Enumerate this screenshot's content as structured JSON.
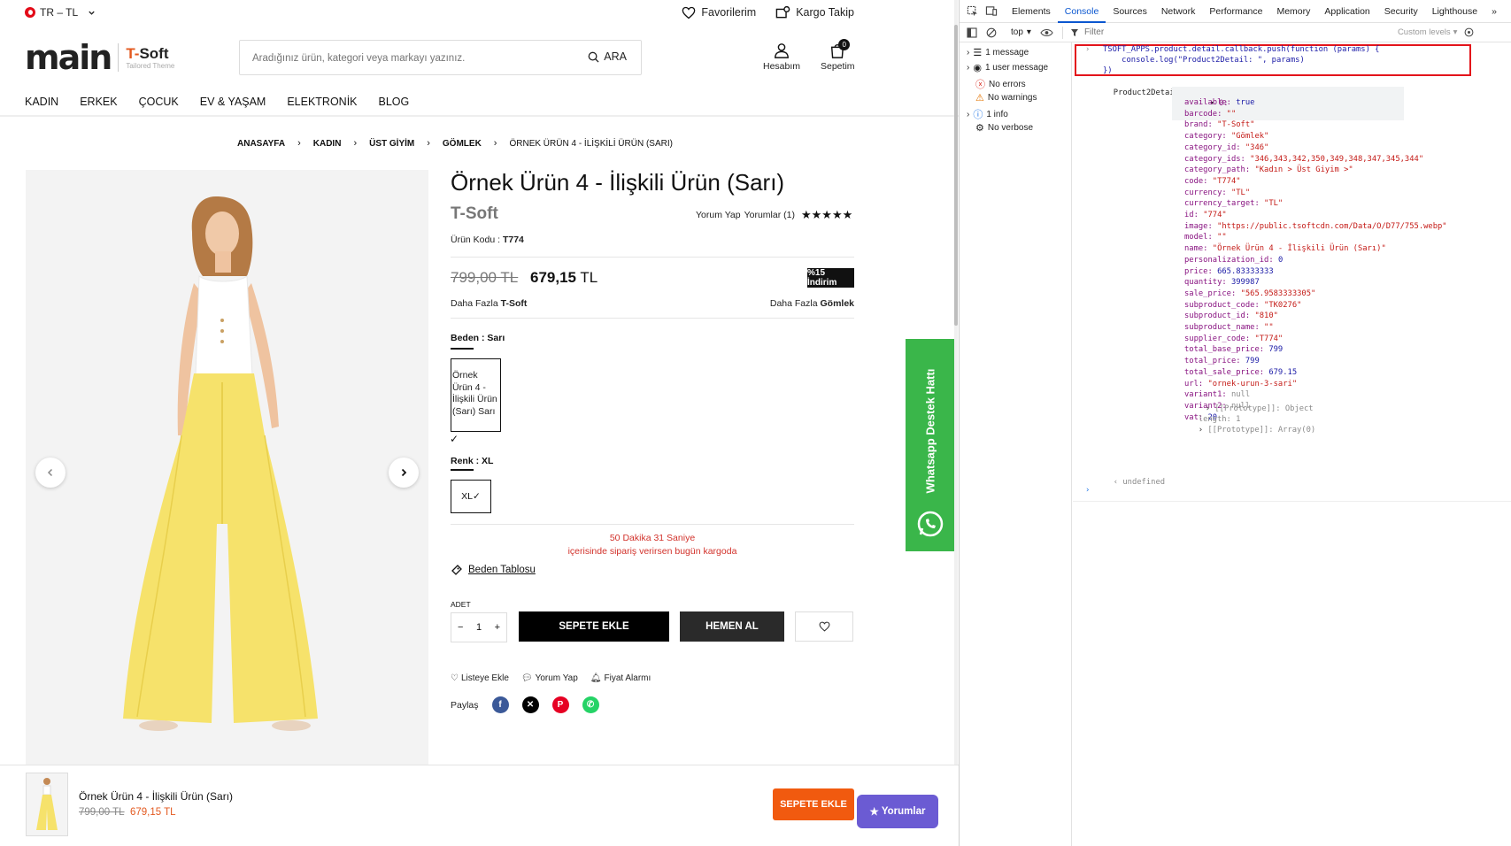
{
  "shop": {
    "locale": "TR – TL",
    "top_links": {
      "favorites": "Favorilerim",
      "cargo": "Kargo Takip"
    },
    "logo": {
      "main": "main",
      "tsoft_t": "T-",
      "tsoft_soft": "Soft",
      "tagline": "Tailored Theme"
    },
    "search": {
      "placeholder": "Aradığınız ürün, kategori veya markayı yazınız.",
      "button": "ARA"
    },
    "account_label": "Hesabım",
    "cart_label": "Sepetim",
    "cart_count": "0",
    "nav": [
      "KADIN",
      "ERKEK",
      "ÇOCUK",
      "EV & YAŞAM",
      "ELEKTRONİK",
      "BLOG"
    ],
    "breadcrumb": [
      "ANASAYFA",
      "KADIN",
      "ÜST GİYİM",
      "GÖMLEK",
      "ÖRNEK ÜRÜN 4 - İLİŞKİLİ ÜRÜN (SARI)"
    ],
    "product": {
      "title": "Örnek Ürün 4 - İlişkili Ürün (Sarı)",
      "brand": "T-Soft",
      "review_link": "Yorum Yap",
      "reviews_count": "Yorumlar (1)",
      "rating": 5,
      "code_label": "Ürün Kodu :",
      "code": "T774",
      "old_price": "799,00 TL",
      "price_value": "679,15",
      "price_currency": "TL",
      "discount": "%15 İndirim",
      "more_brand_label": "Daha Fazla",
      "more_brand": "T-Soft",
      "more_cat_label": "Daha Fazla",
      "more_cat": "Gömlek",
      "size_option_label": "Beden : Sarı",
      "variant_alt": "Örnek Ürün 4 - İlişkili Ürün (Sarı) Sarı",
      "color_option_label": "Renk : XL",
      "size_value": "XL",
      "timer_line1": "50 Dakika 31 Saniye",
      "timer_line2": "içerisinde sipariş verirsen bugün kargoda",
      "size_table": "Beden Tablosu",
      "qty_label": "ADET",
      "qty": "1",
      "add_to_cart": "SEPETE EKLE",
      "buy_now": "HEMEN AL",
      "mini_actions": [
        "Listeye Ekle",
        "Yorum Yap",
        "Fiyat Alarmı"
      ],
      "share_label": "Paylaş"
    },
    "whatsapp": "Whatsapp Destek Hattı",
    "sticky": {
      "name": "Örnek Ürün 4 - İlişkili Ürün (Sarı)",
      "old_price": "799,00 TL",
      "price": "679,15 TL",
      "add_to_cart": "SEPETE EKLE",
      "reviews": "Yorumlar"
    }
  },
  "devtools": {
    "tabs": [
      "Elements",
      "Console",
      "Sources",
      "Network",
      "Performance",
      "Memory",
      "Application",
      "Security",
      "Lighthouse"
    ],
    "active_tab": "Console",
    "context": "top",
    "filter_placeholder": "Filter",
    "levels": "Custom levels",
    "sidebar": [
      "1 message",
      "1 user message",
      "No errors",
      "No warnings",
      "1 info",
      "No verbose"
    ],
    "code": [
      "TSOFT_APPS.product.detail.callback.push(function (params) {",
      "    console.log(\"Product2Detail: \", params)",
      "})"
    ],
    "log_label": "Product2Detail: ",
    "array_summary": "[{…}]",
    "index_label": "0:",
    "fields": [
      {
        "key": "available",
        "value": "true",
        "type": "bool"
      },
      {
        "key": "barcode",
        "value": "\"\"",
        "type": "str"
      },
      {
        "key": "brand",
        "value": "\"T-Soft\"",
        "type": "str"
      },
      {
        "key": "category",
        "value": "\"Gömlek\"",
        "type": "str"
      },
      {
        "key": "category_id",
        "value": "\"346\"",
        "type": "str"
      },
      {
        "key": "category_ids",
        "value": "\"346,343,342,350,349,348,347,345,344\"",
        "type": "str"
      },
      {
        "key": "category_path",
        "value": "\"Kadın > Üst Giyim >\"",
        "type": "str"
      },
      {
        "key": "code",
        "value": "\"T774\"",
        "type": "str"
      },
      {
        "key": "currency",
        "value": "\"TL\"",
        "type": "str"
      },
      {
        "key": "currency_target",
        "value": "\"TL\"",
        "type": "str"
      },
      {
        "key": "id",
        "value": "\"774\"",
        "type": "str"
      },
      {
        "key": "image",
        "value": "\"https://public.tsoftcdn.com/Data/O/D77/755.webp\"",
        "type": "str"
      },
      {
        "key": "model",
        "value": "\"\"",
        "type": "str"
      },
      {
        "key": "name",
        "value": "\"Örnek Ürün 4 - İlişkili Ürün (Sarı)\"",
        "type": "str"
      },
      {
        "key": "personalization_id",
        "value": "0",
        "type": "num"
      },
      {
        "key": "price",
        "value": "665.83333333",
        "type": "num"
      },
      {
        "key": "quantity",
        "value": "399987",
        "type": "num"
      },
      {
        "key": "sale_price",
        "value": "\"565.9583333305\"",
        "type": "str"
      },
      {
        "key": "subproduct_code",
        "value": "\"TK0276\"",
        "type": "str"
      },
      {
        "key": "subproduct_id",
        "value": "\"810\"",
        "type": "str"
      },
      {
        "key": "subproduct_name",
        "value": "\"\"",
        "type": "str"
      },
      {
        "key": "supplier_code",
        "value": "\"T774\"",
        "type": "str"
      },
      {
        "key": "total_base_price",
        "value": "799",
        "type": "num"
      },
      {
        "key": "total_price",
        "value": "799",
        "type": "num"
      },
      {
        "key": "total_sale_price",
        "value": "679.15",
        "type": "num"
      },
      {
        "key": "url",
        "value": "\"ornek-urun-3-sari\"",
        "type": "str"
      },
      {
        "key": "variant1",
        "value": "null",
        "type": "null"
      },
      {
        "key": "variant2",
        "value": "null",
        "type": "null"
      },
      {
        "key": "vat",
        "value": "20",
        "type": "num"
      }
    ],
    "proto_object": "[[Prototype]]: Object",
    "length_line": "length: 1",
    "proto_array": "[[Prototype]]: Array(0)",
    "undefined": "undefined",
    "colors": {
      "tab_active": "#0b57d0",
      "highlight_border": "#e3141b",
      "string": "#c41a16",
      "keyword": "#881280",
      "number": "#1a1aa6"
    }
  }
}
